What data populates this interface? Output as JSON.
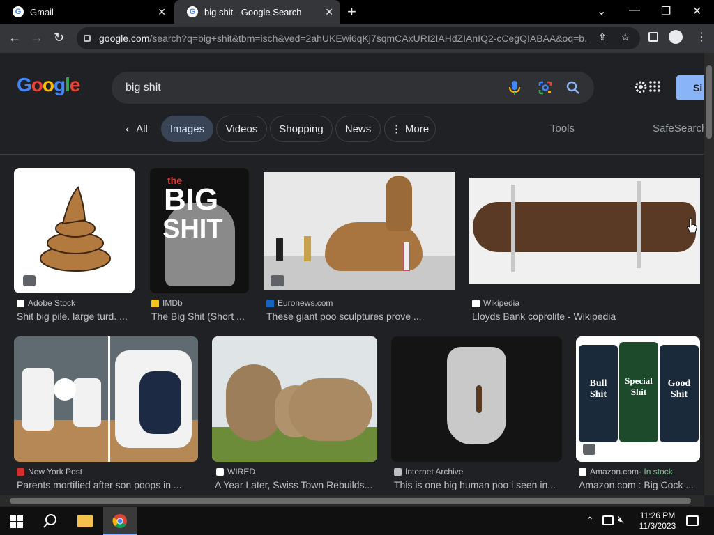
{
  "browser": {
    "tabs": [
      {
        "title": "Gmail"
      },
      {
        "title": "big shit - Google Search"
      }
    ],
    "new_tab_symbol": "+",
    "url_main": "google.com",
    "url_rest": "/search?q=big+shit&tbm=isch&ved=2ahUKEwi6qKj7sqmCAxURI2IAHdZIAnIQ2-cCegQIABAA&oq=b..."
  },
  "google": {
    "logo_text": "Google",
    "query": "big shit",
    "signin": "Si",
    "filters": [
      "All",
      "Images",
      "Videos",
      "Shopping",
      "News",
      "More"
    ],
    "tools": "Tools",
    "safesearch": "SafeSearch"
  },
  "results": [
    {
      "source": "Adobe Stock",
      "caption": "Shit big pile. large turd. ..."
    },
    {
      "source": "IMDb",
      "caption": "The Big Shit (Short ..."
    },
    {
      "source": "Euronews.com",
      "caption": "These giant poo sculptures prove ..."
    },
    {
      "source": "Wikipedia",
      "caption": "Lloyds Bank coprolite - Wikipedia"
    },
    {
      "source": "New York Post",
      "caption": "Parents mortified after son poops in ..."
    },
    {
      "source": "WIRED",
      "caption": "A Year Later, Swiss Town Rebuilds..."
    },
    {
      "source": "Internet Archive",
      "caption": "This is one big human poo i seen in..."
    },
    {
      "source": "Amazon.com",
      "source_extra": " · In stock",
      "caption": "Amazon.com : Big Cock ..."
    }
  ],
  "image_text": {
    "imdb_the": "the",
    "imdb_big": "BIG",
    "imdb_shit": "SHIT",
    "amazon_labels": [
      "Bull Shit",
      "Special Shit",
      "Good Shit"
    ]
  },
  "taskbar": {
    "time": "11:26 PM",
    "date": "11/3/2023"
  },
  "colors": {
    "bg": "#202124",
    "pill_active": "#394457",
    "signin": "#8ab4f8",
    "in_stock": "#81c995"
  }
}
